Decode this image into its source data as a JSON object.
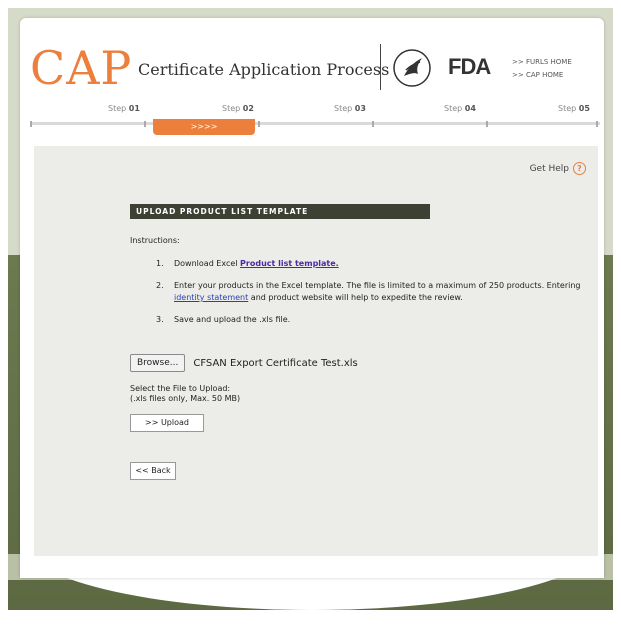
{
  "header": {
    "brand_big": "CAP",
    "brand_sub": "Certificate Application Process",
    "agency_logo": "FDA",
    "links": [
      ">> FURLS HOME",
      ">> CAP HOME"
    ]
  },
  "steps": [
    {
      "prefix": "Step",
      "num": "01"
    },
    {
      "prefix": "Step",
      "num": "02"
    },
    {
      "prefix": "Step",
      "num": "03"
    },
    {
      "prefix": "Step",
      "num": "04"
    },
    {
      "prefix": "Step",
      "num": "05"
    }
  ],
  "progress": {
    "label": ">>>>",
    "current_step": 2
  },
  "help": {
    "label": "Get Help",
    "icon": "question-icon",
    "icon_glyph": "?"
  },
  "section": {
    "title": "UPLOAD PRODUCT LIST TEMPLATE"
  },
  "instructions": {
    "label": "Instructions:",
    "items": [
      {
        "num": "1.",
        "text": "Download Excel ",
        "link": "Product list template."
      },
      {
        "num": "2.",
        "text_before": "Enter your products in the Excel template. The file is limited to a maximum of 250 products. Entering ",
        "link": "identity statement",
        "text_after": " and product website will help to expedite the review."
      },
      {
        "num": "3.",
        "text": "Save and upload the .xls file."
      }
    ]
  },
  "file_input": {
    "button_label": "Browse...",
    "filename": "CFSAN Export Certificate Test.xls"
  },
  "select_label": {
    "line1": "Select the File to Upload:",
    "line2": "(.xls files only, Max. 50 MB)"
  },
  "buttons": {
    "upload": ">> Upload",
    "back": "<< Back"
  },
  "colors": {
    "accent": "#ec7f3c",
    "section_bar": "#3d4133",
    "link": "#2a3fb5"
  }
}
